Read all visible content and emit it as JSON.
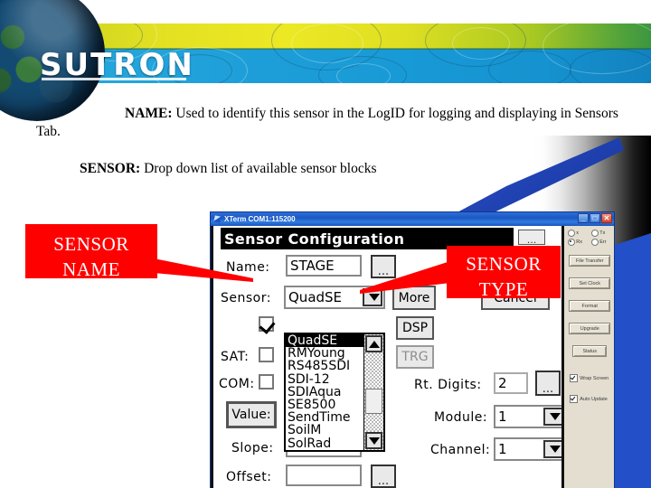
{
  "brand": {
    "logo": "SUTRON"
  },
  "slide": {
    "paragraph_name_label": "NAME:",
    "paragraph_name_text": " Used to identify this sensor in the LogID for logging and displaying in Sensors Tab.",
    "paragraph_sensor_label": "SENSOR:",
    "paragraph_sensor_text": " Drop down list of available sensor blocks"
  },
  "callouts": {
    "name": "SENSOR\nNAME",
    "name_line1": "SENSOR",
    "name_line2": "NAME",
    "type_line1": "SENSOR",
    "type_line2": "TYPE",
    "color": "#fe0000"
  },
  "window": {
    "title": "XTerm COM1:115200",
    "minimize": "_",
    "maximize": "□",
    "close": "✕"
  },
  "dialog": {
    "heading": "Sensor Configuration",
    "top_dots_button": "...",
    "fields": {
      "name_label": "Name:",
      "name_value": "STAGE",
      "name_dots": "...",
      "sensor_label": "Sensor:",
      "sensor_value": "QuadSE",
      "more_button": "More",
      "cancel_button": "Cancel",
      "dsp_button": "DSP",
      "trg_button": "TRG",
      "sat_label": "SAT:",
      "com_label": "COM:",
      "value_button": "Value:",
      "slope_label": "Slope:",
      "offset_label": "Offset:",
      "offset_dots": "...",
      "rt_digits_label": "Rt. Digits:",
      "rt_digits_value": "2",
      "rt_digits_dots": "...",
      "module_label": "Module:",
      "module_value": "1",
      "channel_label": "Channel:",
      "channel_value": "1"
    },
    "dropdown": {
      "selected": "QuadSE",
      "items": [
        "QuadSE",
        "RMYoung",
        "RS485SDI",
        "SDI-12",
        "SDIAqua",
        "SE8500",
        "SendTime",
        "SoilM",
        "SolRad"
      ]
    }
  },
  "sidebar": {
    "radios": [
      {
        "label": "x",
        "selected": false
      },
      {
        "label": "Tx",
        "selected": false
      },
      {
        "label": "Rx",
        "selected": true
      },
      {
        "label": "Err",
        "selected": false
      }
    ],
    "buttons": [
      "File Transfer",
      "Set Clock",
      "Format",
      "Upgrade",
      "Status"
    ],
    "checkboxes": [
      {
        "label": "Wrap Screen",
        "checked": true
      },
      {
        "label": "Auto Update",
        "checked": true
      }
    ]
  }
}
